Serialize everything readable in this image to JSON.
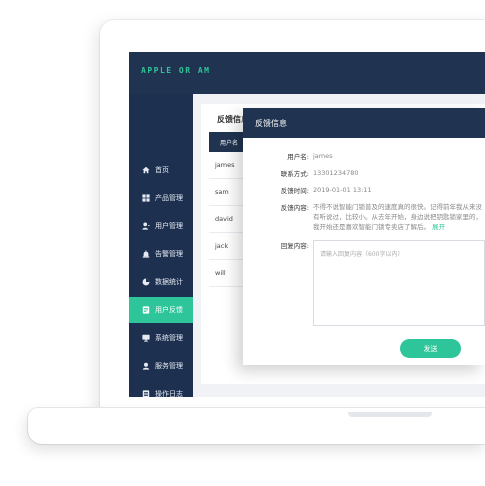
{
  "app": {
    "logo_text": "APPLE OR AM"
  },
  "sidebar": {
    "items": [
      {
        "label": "首页",
        "icon": "home-icon"
      },
      {
        "label": "产品管理",
        "icon": "grid-icon"
      },
      {
        "label": "用户管理",
        "icon": "user-icon"
      },
      {
        "label": "告警管理",
        "icon": "alarm-icon"
      },
      {
        "label": "数据统计",
        "icon": "chart-icon"
      },
      {
        "label": "用户反馈",
        "icon": "feedback-icon",
        "active": true
      },
      {
        "label": "系统管理",
        "icon": "monitor-icon"
      },
      {
        "label": "服务管理",
        "icon": "service-icon"
      },
      {
        "label": "操作日志",
        "icon": "log-icon"
      }
    ]
  },
  "page": {
    "title": "反馈信息",
    "table": {
      "header": "用户名",
      "rows": [
        "james",
        "sam",
        "david",
        "jack",
        "will"
      ]
    }
  },
  "modal": {
    "title": "反馈信息",
    "fields": {
      "username_label": "用户名:",
      "username_value": "james",
      "phone_label": "联系方式:",
      "phone_value": "13301234780",
      "time_label": "反馈时间:",
      "time_value": "2019-01-01 13:11",
      "content_label": "反馈内容:",
      "content_value": "不得不说智能门锁普及的速度真的很快。记得前年我从来没有听说过，比较小。从去年开始，身边说把钥匙锁家里的，我开始还是喜欢智能门锁专卖店了解后。",
      "expand_label": "展开",
      "reply_label": "回复内容:",
      "reply_placeholder": "请输入回复内容（600字以内）"
    },
    "send_label": "发送"
  },
  "colors": {
    "navy": "#203350",
    "sidebar": "#1d3050",
    "accent": "#2fc59a"
  }
}
